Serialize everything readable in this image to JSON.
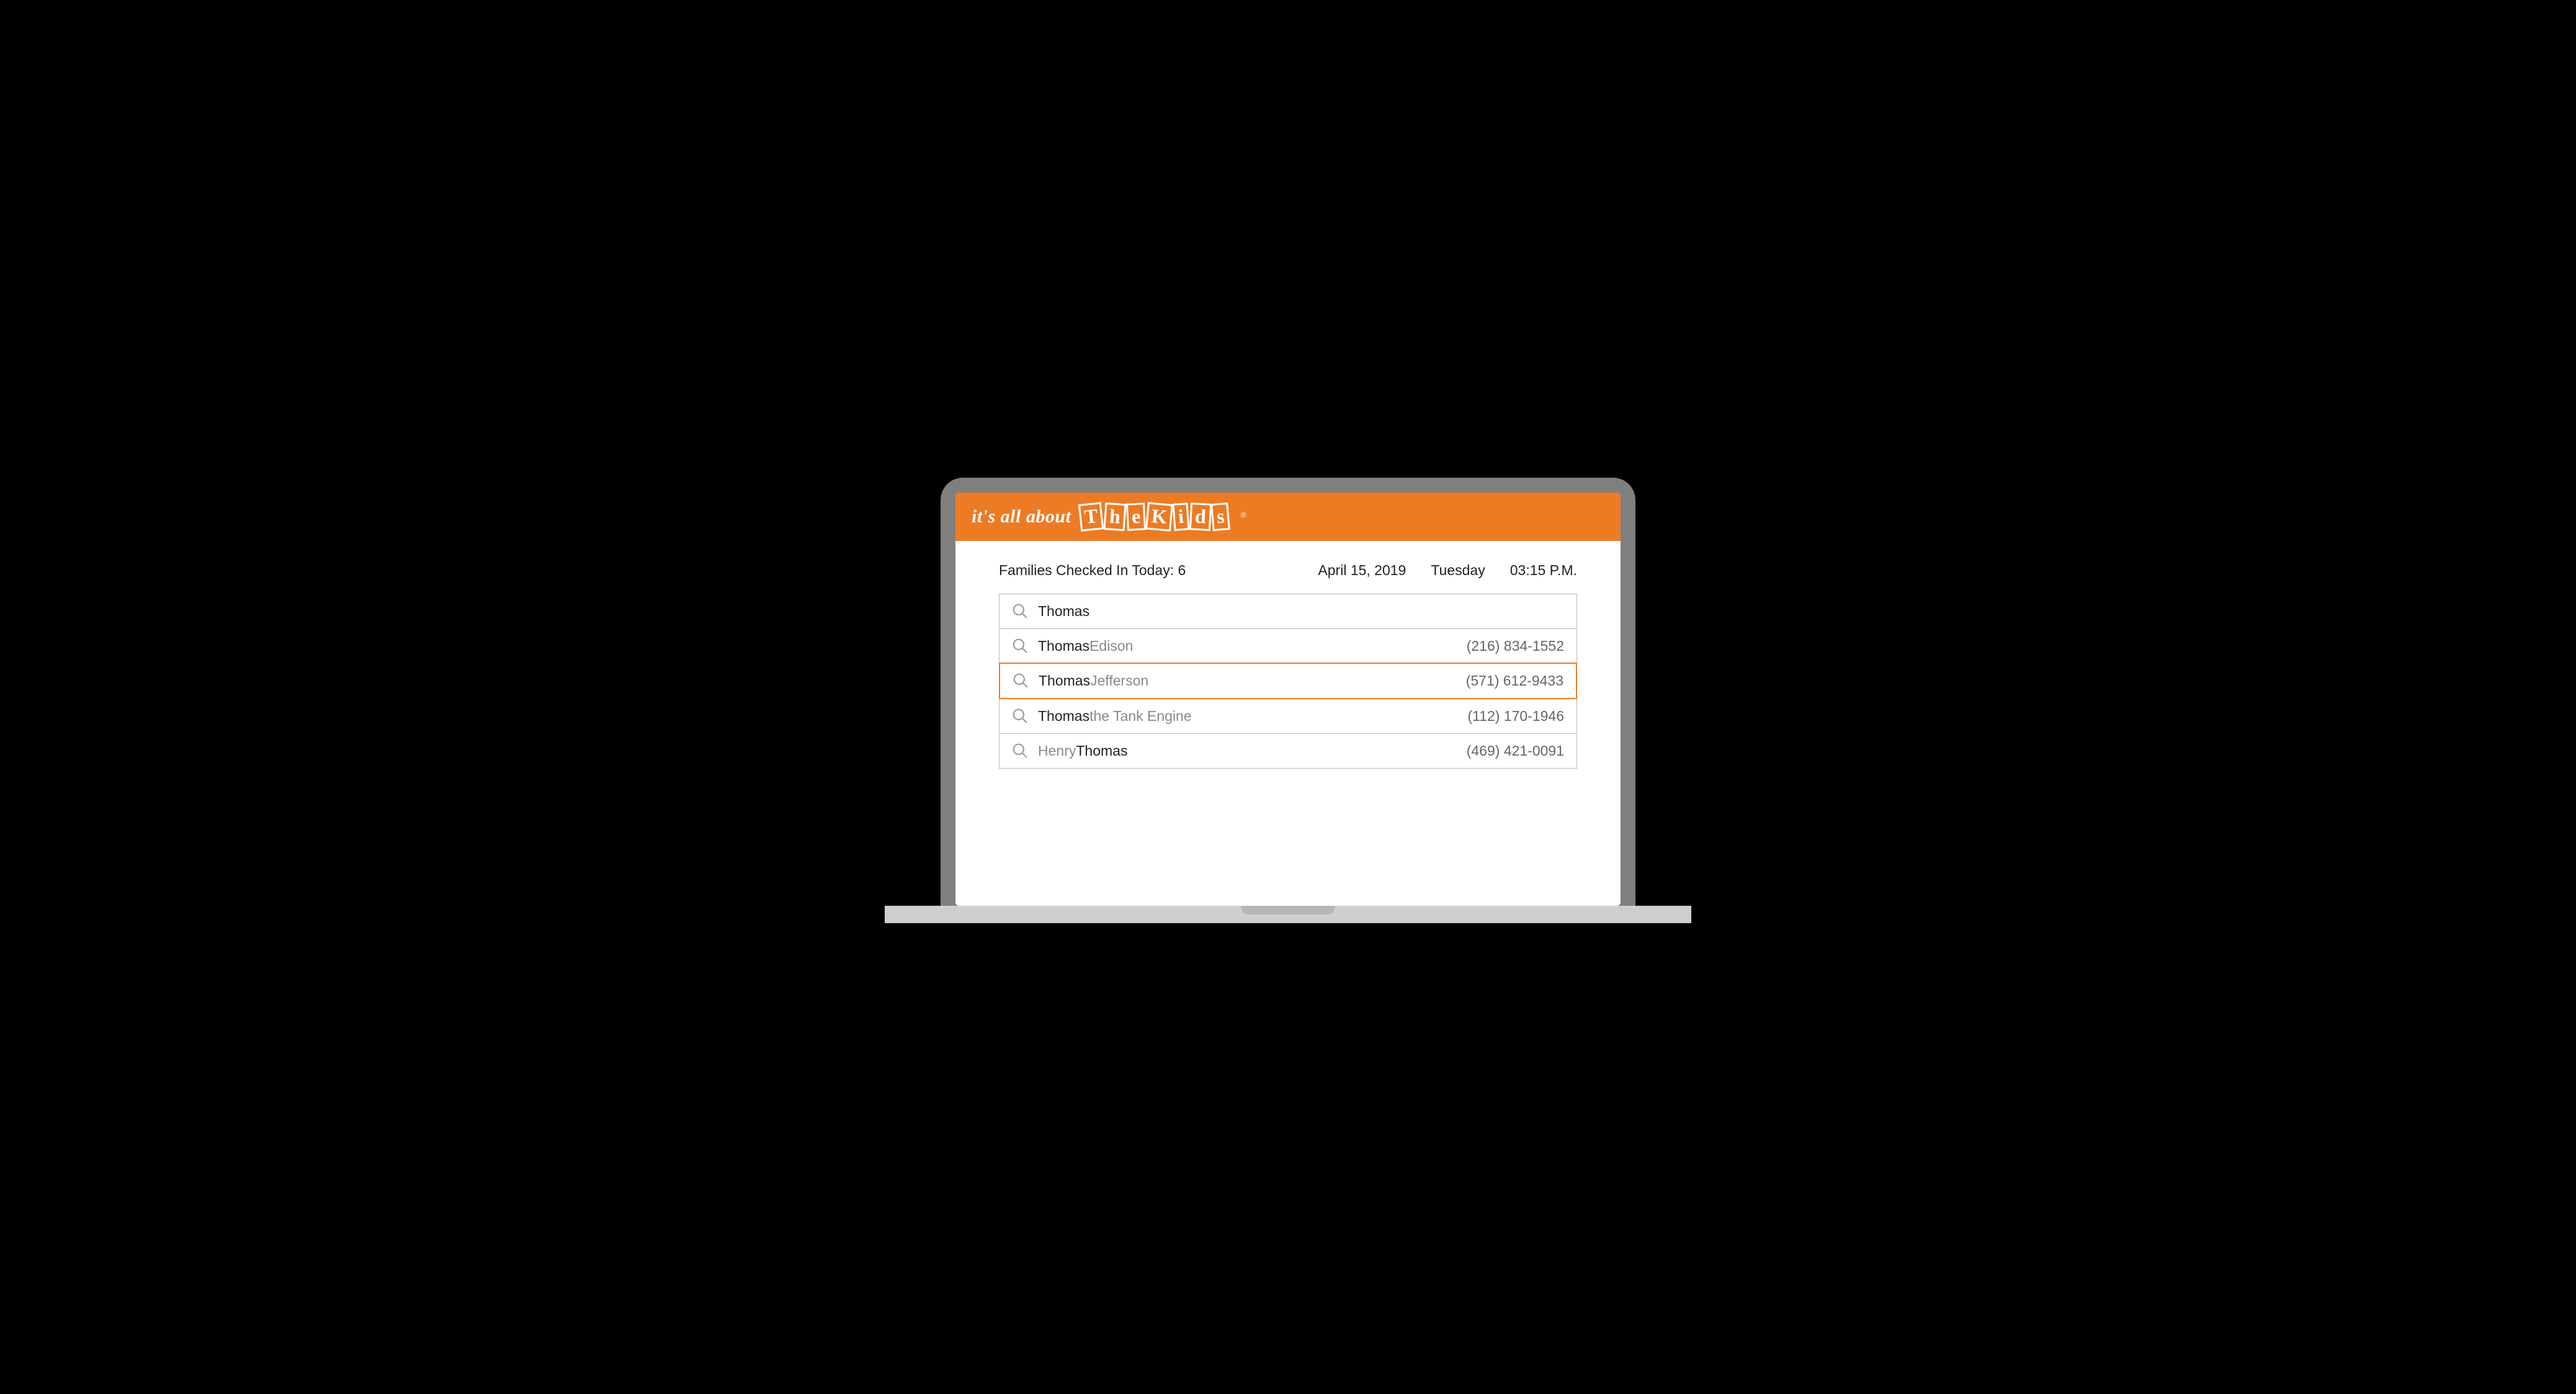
{
  "brand": {
    "prefix": "it's all about",
    "boxes": [
      "T",
      "h",
      "e",
      "K",
      "i",
      "d",
      "s"
    ],
    "reg": "®"
  },
  "status": {
    "checkin_label": "Families Checked In Today: 6",
    "date": "April 15, 2019",
    "day": "Tuesday",
    "time": "03:15 P.M."
  },
  "search": {
    "value": "Thomas",
    "results": [
      {
        "match": "Thomas",
        "rest": " Edison",
        "phone": "(216) 834-1552",
        "highlight": false
      },
      {
        "match": "Thomas",
        "rest": " Jefferson",
        "phone": "(571) 612-9433",
        "highlight": true
      },
      {
        "match": "Thomas",
        "rest": " the Tank Engine",
        "phone": "(112) 170-1946",
        "highlight": false
      },
      {
        "match": "Thomas",
        "rest": "",
        "pre": "Henry ",
        "phone": "(469) 421-0091",
        "highlight": false
      }
    ]
  }
}
